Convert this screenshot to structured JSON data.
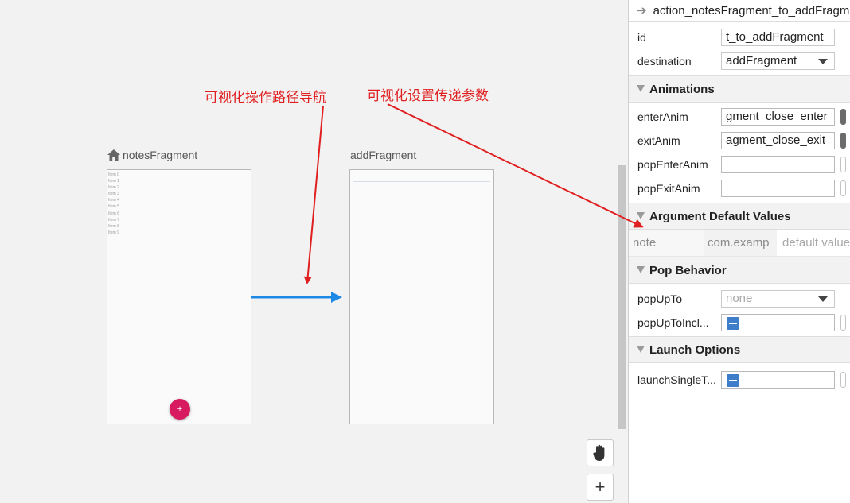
{
  "canvas": {
    "notes_fragment": {
      "title": "notesFragment",
      "items": [
        "Item 0",
        "Item 1",
        "Item 2",
        "Item 3",
        "Item 4",
        "Item 5",
        "Item 6",
        "Item 7",
        "Item 8",
        "Item 9"
      ],
      "fab_label": "+"
    },
    "add_fragment": {
      "title": "addFragment"
    },
    "annotations": {
      "navigation": "可视化操作路径导航",
      "arguments": "可视化设置传递参数"
    },
    "tools": {
      "pan_icon": "hand-icon",
      "zoom_in_label": "+"
    },
    "colors": {
      "action_arrow": "#1e88e5",
      "annotation": "#e02020",
      "fab": "#d81b60"
    }
  },
  "panel": {
    "header": {
      "arrow_glyph": "➔",
      "title": "action_notesFragment_to_addFragment"
    },
    "id": {
      "label": "id",
      "value": "t_to_addFragment"
    },
    "destination": {
      "label": "destination",
      "value": "addFragment"
    },
    "animations": {
      "title": "Animations",
      "enter_anim": {
        "label": "enterAnim",
        "value": "gment_close_enter"
      },
      "exit_anim": {
        "label": "exitAnim",
        "value": "agment_close_exit"
      },
      "pop_enter_anim": {
        "label": "popEnterAnim",
        "value": ""
      },
      "pop_exit_anim": {
        "label": "popExitAnim",
        "value": ""
      }
    },
    "arguments": {
      "title": "Argument Default Values",
      "row": {
        "name": "note",
        "type": "com.examp",
        "default": "default value"
      }
    },
    "pop_behavior": {
      "title": "Pop Behavior",
      "pop_up_to": {
        "label": "popUpTo",
        "value": "none"
      },
      "pop_up_to_inclusive": {
        "label": "popUpToIncl..."
      }
    },
    "launch_options": {
      "title": "Launch Options",
      "launch_single_top": {
        "label": "launchSingleT..."
      }
    }
  }
}
